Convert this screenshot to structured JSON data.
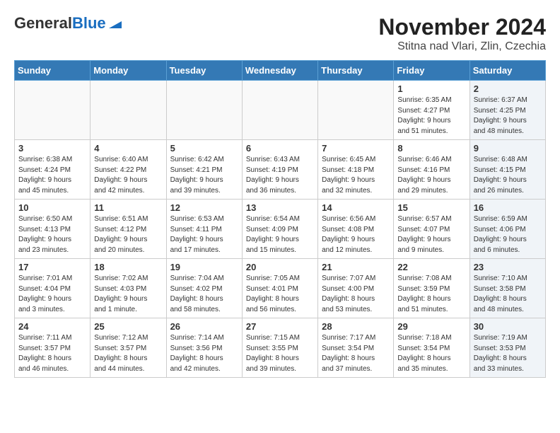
{
  "header": {
    "logo_line1": "General",
    "logo_line2": "Blue",
    "month": "November 2024",
    "location": "Stitna nad Vlari, Zlin, Czechia"
  },
  "days_of_week": [
    "Sunday",
    "Monday",
    "Tuesday",
    "Wednesday",
    "Thursday",
    "Friday",
    "Saturday"
  ],
  "weeks": [
    [
      {
        "day": "",
        "info": "",
        "shaded": false
      },
      {
        "day": "",
        "info": "",
        "shaded": false
      },
      {
        "day": "",
        "info": "",
        "shaded": false
      },
      {
        "day": "",
        "info": "",
        "shaded": false
      },
      {
        "day": "",
        "info": "",
        "shaded": false
      },
      {
        "day": "1",
        "info": "Sunrise: 6:35 AM\nSunset: 4:27 PM\nDaylight: 9 hours\nand 51 minutes.",
        "shaded": false
      },
      {
        "day": "2",
        "info": "Sunrise: 6:37 AM\nSunset: 4:25 PM\nDaylight: 9 hours\nand 48 minutes.",
        "shaded": true
      }
    ],
    [
      {
        "day": "3",
        "info": "Sunrise: 6:38 AM\nSunset: 4:24 PM\nDaylight: 9 hours\nand 45 minutes.",
        "shaded": false
      },
      {
        "day": "4",
        "info": "Sunrise: 6:40 AM\nSunset: 4:22 PM\nDaylight: 9 hours\nand 42 minutes.",
        "shaded": false
      },
      {
        "day": "5",
        "info": "Sunrise: 6:42 AM\nSunset: 4:21 PM\nDaylight: 9 hours\nand 39 minutes.",
        "shaded": false
      },
      {
        "day": "6",
        "info": "Sunrise: 6:43 AM\nSunset: 4:19 PM\nDaylight: 9 hours\nand 36 minutes.",
        "shaded": false
      },
      {
        "day": "7",
        "info": "Sunrise: 6:45 AM\nSunset: 4:18 PM\nDaylight: 9 hours\nand 32 minutes.",
        "shaded": false
      },
      {
        "day": "8",
        "info": "Sunrise: 6:46 AM\nSunset: 4:16 PM\nDaylight: 9 hours\nand 29 minutes.",
        "shaded": false
      },
      {
        "day": "9",
        "info": "Sunrise: 6:48 AM\nSunset: 4:15 PM\nDaylight: 9 hours\nand 26 minutes.",
        "shaded": true
      }
    ],
    [
      {
        "day": "10",
        "info": "Sunrise: 6:50 AM\nSunset: 4:13 PM\nDaylight: 9 hours\nand 23 minutes.",
        "shaded": false
      },
      {
        "day": "11",
        "info": "Sunrise: 6:51 AM\nSunset: 4:12 PM\nDaylight: 9 hours\nand 20 minutes.",
        "shaded": false
      },
      {
        "day": "12",
        "info": "Sunrise: 6:53 AM\nSunset: 4:11 PM\nDaylight: 9 hours\nand 17 minutes.",
        "shaded": false
      },
      {
        "day": "13",
        "info": "Sunrise: 6:54 AM\nSunset: 4:09 PM\nDaylight: 9 hours\nand 15 minutes.",
        "shaded": false
      },
      {
        "day": "14",
        "info": "Sunrise: 6:56 AM\nSunset: 4:08 PM\nDaylight: 9 hours\nand 12 minutes.",
        "shaded": false
      },
      {
        "day": "15",
        "info": "Sunrise: 6:57 AM\nSunset: 4:07 PM\nDaylight: 9 hours\nand 9 minutes.",
        "shaded": false
      },
      {
        "day": "16",
        "info": "Sunrise: 6:59 AM\nSunset: 4:06 PM\nDaylight: 9 hours\nand 6 minutes.",
        "shaded": true
      }
    ],
    [
      {
        "day": "17",
        "info": "Sunrise: 7:01 AM\nSunset: 4:04 PM\nDaylight: 9 hours\nand 3 minutes.",
        "shaded": false
      },
      {
        "day": "18",
        "info": "Sunrise: 7:02 AM\nSunset: 4:03 PM\nDaylight: 9 hours\nand 1 minute.",
        "shaded": false
      },
      {
        "day": "19",
        "info": "Sunrise: 7:04 AM\nSunset: 4:02 PM\nDaylight: 8 hours\nand 58 minutes.",
        "shaded": false
      },
      {
        "day": "20",
        "info": "Sunrise: 7:05 AM\nSunset: 4:01 PM\nDaylight: 8 hours\nand 56 minutes.",
        "shaded": false
      },
      {
        "day": "21",
        "info": "Sunrise: 7:07 AM\nSunset: 4:00 PM\nDaylight: 8 hours\nand 53 minutes.",
        "shaded": false
      },
      {
        "day": "22",
        "info": "Sunrise: 7:08 AM\nSunset: 3:59 PM\nDaylight: 8 hours\nand 51 minutes.",
        "shaded": false
      },
      {
        "day": "23",
        "info": "Sunrise: 7:10 AM\nSunset: 3:58 PM\nDaylight: 8 hours\nand 48 minutes.",
        "shaded": true
      }
    ],
    [
      {
        "day": "24",
        "info": "Sunrise: 7:11 AM\nSunset: 3:57 PM\nDaylight: 8 hours\nand 46 minutes.",
        "shaded": false
      },
      {
        "day": "25",
        "info": "Sunrise: 7:12 AM\nSunset: 3:57 PM\nDaylight: 8 hours\nand 44 minutes.",
        "shaded": false
      },
      {
        "day": "26",
        "info": "Sunrise: 7:14 AM\nSunset: 3:56 PM\nDaylight: 8 hours\nand 42 minutes.",
        "shaded": false
      },
      {
        "day": "27",
        "info": "Sunrise: 7:15 AM\nSunset: 3:55 PM\nDaylight: 8 hours\nand 39 minutes.",
        "shaded": false
      },
      {
        "day": "28",
        "info": "Sunrise: 7:17 AM\nSunset: 3:54 PM\nDaylight: 8 hours\nand 37 minutes.",
        "shaded": false
      },
      {
        "day": "29",
        "info": "Sunrise: 7:18 AM\nSunset: 3:54 PM\nDaylight: 8 hours\nand 35 minutes.",
        "shaded": false
      },
      {
        "day": "30",
        "info": "Sunrise: 7:19 AM\nSunset: 3:53 PM\nDaylight: 8 hours\nand 33 minutes.",
        "shaded": true
      }
    ]
  ]
}
